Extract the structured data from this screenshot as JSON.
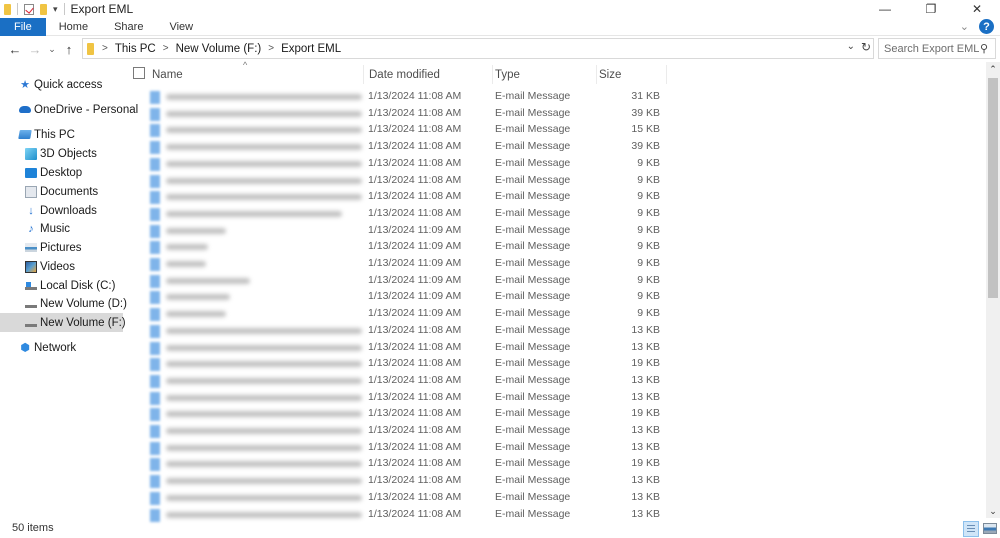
{
  "window": {
    "title": "Export EML",
    "quick_access_toolbar": [
      "folder-icon",
      "properties-icon",
      "new-folder-icon",
      "customize-dropdown-icon"
    ],
    "controls": {
      "minimize": "—",
      "maximize": "❐",
      "close": "✕"
    }
  },
  "ribbon": {
    "tabs": [
      {
        "label": "File",
        "active": true
      },
      {
        "label": "Home"
      },
      {
        "label": "Share"
      },
      {
        "label": "View"
      }
    ],
    "expand_glyph": "⌄",
    "help_glyph": "?"
  },
  "navigation": {
    "back_glyph": "←",
    "forward_glyph": "→",
    "recent_glyph": "⌄",
    "up_glyph": "↑",
    "breadcrumb": [
      "This PC",
      "New Volume (F:)",
      "Export EML"
    ],
    "crumb_separator": ">",
    "address_dropdown_glyph": "⌄",
    "refresh_glyph": "↻",
    "search": {
      "placeholder": "Search Export EML",
      "value": "",
      "icon_glyph": "⚲"
    }
  },
  "sidebar": {
    "items": [
      {
        "label": "Quick access",
        "icon": "star-icon",
        "level": 0
      },
      {
        "label": "OneDrive - Personal",
        "icon": "cloud-icon",
        "level": 0
      },
      {
        "label": "This PC",
        "icon": "computer-icon",
        "level": 0
      },
      {
        "label": "3D Objects",
        "icon": "3d-objects-icon",
        "level": 1
      },
      {
        "label": "Desktop",
        "icon": "desktop-icon",
        "level": 1
      },
      {
        "label": "Documents",
        "icon": "documents-icon",
        "level": 1
      },
      {
        "label": "Downloads",
        "icon": "downloads-icon",
        "level": 1
      },
      {
        "label": "Music",
        "icon": "music-icon",
        "level": 1
      },
      {
        "label": "Pictures",
        "icon": "pictures-icon",
        "level": 1
      },
      {
        "label": "Videos",
        "icon": "videos-icon",
        "level": 1
      },
      {
        "label": "Local Disk (C:)",
        "icon": "local-disk-icon",
        "level": 1
      },
      {
        "label": "New Volume (D:)",
        "icon": "drive-icon",
        "level": 1
      },
      {
        "label": "New Volume (F:)",
        "icon": "drive-icon",
        "level": 1,
        "selected": true
      },
      {
        "label": "Network",
        "icon": "network-icon",
        "level": 0
      }
    ],
    "glyphs": {
      "star": "★",
      "down": "↓",
      "music": "♪",
      "network": "⬢"
    }
  },
  "file_list": {
    "sort_indicator": "^",
    "columns": {
      "name": "Name",
      "date": "Date modified",
      "type": "Type",
      "size": "Size"
    },
    "name_note": "File names are blurred in the screenshot",
    "rows": [
      {
        "date": "1/13/2024 11:08 AM",
        "type": "E-mail Message",
        "size": "31 KB"
      },
      {
        "date": "1/13/2024 11:08 AM",
        "type": "E-mail Message",
        "size": "39 KB"
      },
      {
        "date": "1/13/2024 11:08 AM",
        "type": "E-mail Message",
        "size": "15 KB"
      },
      {
        "date": "1/13/2024 11:08 AM",
        "type": "E-mail Message",
        "size": "39 KB"
      },
      {
        "date": "1/13/2024 11:08 AM",
        "type": "E-mail Message",
        "size": "9 KB"
      },
      {
        "date": "1/13/2024 11:08 AM",
        "type": "E-mail Message",
        "size": "9 KB"
      },
      {
        "date": "1/13/2024 11:08 AM",
        "type": "E-mail Message",
        "size": "9 KB"
      },
      {
        "date": "1/13/2024 11:08 AM",
        "type": "E-mail Message",
        "size": "9 KB"
      },
      {
        "date": "1/13/2024 11:09 AM",
        "type": "E-mail Message",
        "size": "9 KB"
      },
      {
        "date": "1/13/2024 11:09 AM",
        "type": "E-mail Message",
        "size": "9 KB"
      },
      {
        "date": "1/13/2024 11:09 AM",
        "type": "E-mail Message",
        "size": "9 KB"
      },
      {
        "date": "1/13/2024 11:09 AM",
        "type": "E-mail Message",
        "size": "9 KB"
      },
      {
        "date": "1/13/2024 11:09 AM",
        "type": "E-mail Message",
        "size": "9 KB"
      },
      {
        "date": "1/13/2024 11:09 AM",
        "type": "E-mail Message",
        "size": "9 KB"
      },
      {
        "date": "1/13/2024 11:08 AM",
        "type": "E-mail Message",
        "size": "13 KB"
      },
      {
        "date": "1/13/2024 11:08 AM",
        "type": "E-mail Message",
        "size": "13 KB"
      },
      {
        "date": "1/13/2024 11:08 AM",
        "type": "E-mail Message",
        "size": "19 KB"
      },
      {
        "date": "1/13/2024 11:08 AM",
        "type": "E-mail Message",
        "size": "13 KB"
      },
      {
        "date": "1/13/2024 11:08 AM",
        "type": "E-mail Message",
        "size": "13 KB"
      },
      {
        "date": "1/13/2024 11:08 AM",
        "type": "E-mail Message",
        "size": "19 KB"
      },
      {
        "date": "1/13/2024 11:08 AM",
        "type": "E-mail Message",
        "size": "13 KB"
      },
      {
        "date": "1/13/2024 11:08 AM",
        "type": "E-mail Message",
        "size": "13 KB"
      },
      {
        "date": "1/13/2024 11:08 AM",
        "type": "E-mail Message",
        "size": "19 KB"
      },
      {
        "date": "1/13/2024 11:08 AM",
        "type": "E-mail Message",
        "size": "13 KB"
      },
      {
        "date": "1/13/2024 11:08 AM",
        "type": "E-mail Message",
        "size": "13 KB"
      },
      {
        "date": "1/13/2024 11:08 AM",
        "type": "E-mail Message",
        "size": "13 KB"
      }
    ]
  },
  "scrollbar": {
    "up_glyph": "⌃",
    "down_glyph": "⌄",
    "visible_fraction": 0.52,
    "scroll_position": 0.0
  },
  "status_bar": {
    "item_count": "50 items",
    "view": "details"
  },
  "colors": {
    "accent": "#1a6fc4",
    "selected_nav": "#d9d9d9",
    "text_secondary": "#5f5f5f"
  }
}
